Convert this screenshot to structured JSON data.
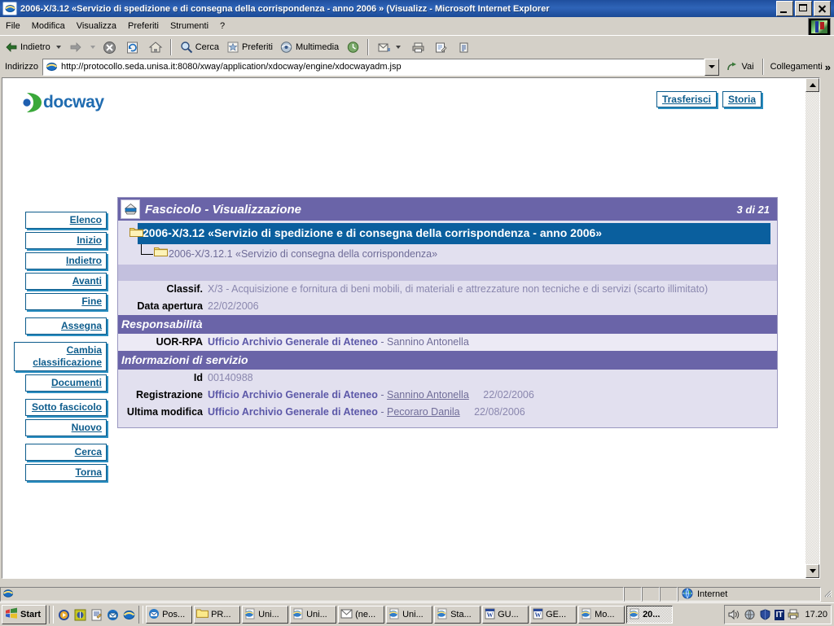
{
  "window": {
    "title": "2006-X/3.12 «Servizio di spedizione e di consegna della corrispondenza - anno 2006 » (Visualizz - Microsoft Internet Explorer",
    "icon": "ie-document-icon",
    "buttons": {
      "minimize": "minimize-button",
      "maximize": "maximize-button",
      "close": "close-button"
    }
  },
  "menubar": {
    "items": [
      {
        "label": "File"
      },
      {
        "label": "Modifica"
      },
      {
        "label": "Visualizza"
      },
      {
        "label": "Preferiti"
      },
      {
        "label": "Strumenti"
      },
      {
        "label": "?"
      }
    ]
  },
  "toolbar": {
    "back": "Indietro",
    "forward": "",
    "stop": "stop-icon",
    "refresh": "refresh-icon",
    "home": "home-icon",
    "search": "Cerca",
    "favorites": "Preferiti",
    "media": "Multimedia",
    "history": "history-icon",
    "mail": "mail-icon",
    "print": "print-icon",
    "edit": "edit-icon",
    "discuss": "discuss-icon"
  },
  "address": {
    "label": "Indirizzo",
    "url": "http://protocollo.seda.unisa.it:8080/xway/application/xdocway/engine/xdocwayadm.jsp",
    "go": "Vai",
    "links": "Collegamenti"
  },
  "page": {
    "logo": "docway",
    "topnav": [
      {
        "label": "Trasferisci"
      },
      {
        "label": "Storia"
      }
    ],
    "sidebar": [
      {
        "label": "Elenco",
        "gap": false,
        "wide": false
      },
      {
        "label": "Inizio",
        "gap": false,
        "wide": false
      },
      {
        "label": "Indietro",
        "gap": false,
        "wide": false
      },
      {
        "label": "Avanti",
        "gap": false,
        "wide": false
      },
      {
        "label": "Fine",
        "gap": false,
        "wide": false
      },
      {
        "label": "Assegna",
        "gap": true,
        "wide": false
      },
      {
        "label": "Cambia classificazione",
        "gap": true,
        "wide": true
      },
      {
        "label": "Documenti",
        "gap": false,
        "wide": false
      },
      {
        "label": "Sotto fascicolo",
        "gap": true,
        "wide": false
      },
      {
        "label": "Nuovo",
        "gap": false,
        "wide": false
      },
      {
        "label": "Cerca",
        "gap": true,
        "wide": false
      },
      {
        "label": "Torna",
        "gap": false,
        "wide": false
      }
    ],
    "record": {
      "header_title": "Fascicolo - Visualizzazione",
      "header_icon": "fascicolo-icon",
      "counter": "3 di 21",
      "tree": {
        "main": "2006-X/3.12 «Servizio di spedizione e di consegna della corrispondenza - anno 2006»",
        "child": "2006-X/3.12.1 «Servizio di consegna della corrispondenza»"
      },
      "fields": [
        {
          "label": "Classif.",
          "value": "X/3 - Acquisizione e fornitura di beni mobili, di materiali e attrezzature non tecniche e di servizi (scarto illimitato)"
        },
        {
          "label": "Data apertura",
          "value": "22/02/2006"
        }
      ],
      "sections": [
        {
          "title": "Responsabilità",
          "rows": [
            {
              "label": "UOR-RPA",
              "office": "Ufficio Archivio Generale di Ateneo",
              "separator": "-",
              "person": "Sannino Antonella",
              "person_link": false,
              "date": ""
            }
          ]
        },
        {
          "title": "Informazioni di servizio",
          "rows": [
            {
              "label": "Id",
              "office": "",
              "separator": "",
              "person": "",
              "person_link": false,
              "date": "",
              "plain": "00140988"
            },
            {
              "label": "Registrazione",
              "office": "Ufficio Archivio Generale di Ateneo",
              "separator": "-",
              "person": "Sannino Antonella",
              "person_link": true,
              "date": "22/02/2006"
            },
            {
              "label": "Ultima modifica",
              "office": "Ufficio Archivio Generale di Ateneo",
              "separator": "-",
              "person": "Pecoraro Danila",
              "person_link": true,
              "date": "22/08/2006"
            }
          ]
        }
      ]
    }
  },
  "statusbar": {
    "message": "",
    "zone": "Internet",
    "zone_icon": "globe-icon"
  },
  "taskbar": {
    "start": "Start",
    "quicklaunch": [
      {
        "name": "media-player-icon"
      },
      {
        "name": "desktop-icon"
      },
      {
        "name": "notepad-icon"
      },
      {
        "name": "outlook-express-icon"
      },
      {
        "name": "internet-explorer-icon"
      }
    ],
    "tasks": [
      {
        "label": "Pos...",
        "icon": "outlook-icon",
        "active": false
      },
      {
        "label": "PR...",
        "icon": "folder-icon",
        "active": false
      },
      {
        "label": "Uni...",
        "icon": "ie-icon",
        "active": false
      },
      {
        "label": "Uni...",
        "icon": "ie-icon",
        "active": false
      },
      {
        "label": "(ne...",
        "icon": "mail-icon",
        "active": false
      },
      {
        "label": "Uni...",
        "icon": "ie-icon",
        "active": false
      },
      {
        "label": "Sta...",
        "icon": "ie-icon",
        "active": false
      },
      {
        "label": "GU...",
        "icon": "word-icon",
        "active": false
      },
      {
        "label": "GE...",
        "icon": "word-icon",
        "active": false
      },
      {
        "label": "Mo...",
        "icon": "ie-icon",
        "active": false
      },
      {
        "label": "20...",
        "icon": "ie-icon",
        "active": true
      }
    ],
    "tray": [
      {
        "name": "volume-icon"
      },
      {
        "name": "network-icon"
      },
      {
        "name": "shield-icon"
      },
      {
        "name": "language-indicator",
        "text": "IT"
      },
      {
        "name": "printer-icon"
      }
    ],
    "clock": "17.20"
  },
  "colors": {
    "titlebar": "#2f64b8",
    "panel_header": "#6a64a8",
    "panel_bg": "#e2e0ef",
    "tree_selected": "#0a5f9e",
    "link_blue": "#0d5c8c",
    "value_grey": "#8a87ae",
    "chrome": "#d4d0c8"
  }
}
